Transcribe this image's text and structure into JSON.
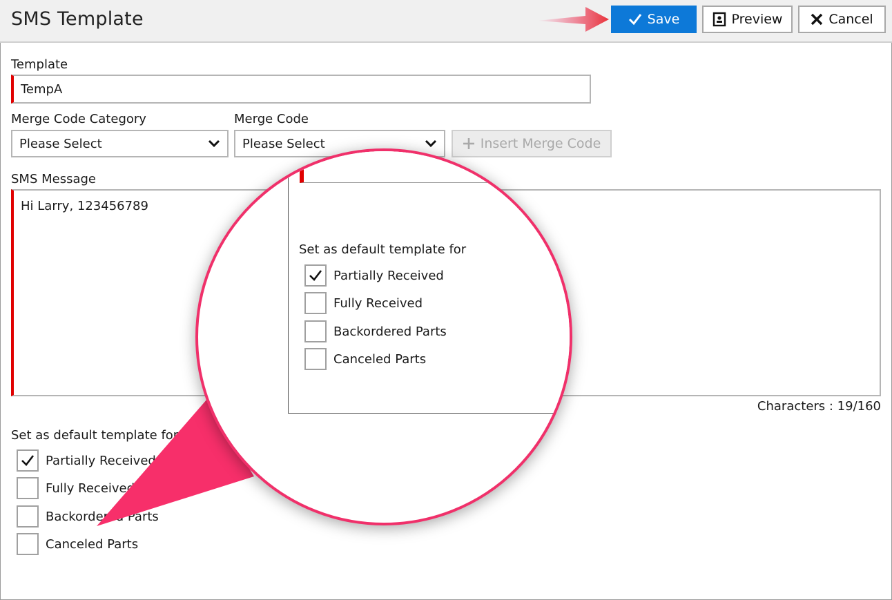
{
  "header": {
    "title": "SMS Template",
    "save_label": "Save",
    "preview_label": "Preview",
    "cancel_label": "Cancel"
  },
  "template": {
    "label": "Template",
    "value": "TempA"
  },
  "merge_code_category": {
    "label": "Merge Code Category",
    "selected": "Please Select"
  },
  "merge_code": {
    "label": "Merge Code",
    "selected": "Please Select"
  },
  "insert_merge_code": {
    "label": "Insert Merge Code"
  },
  "sms_message": {
    "label": "SMS Message",
    "value": "Hi Larry, 123456789",
    "counter": "Characters : 19/160"
  },
  "defaults": {
    "label": "Set as default template for",
    "options": [
      {
        "label": "Partially Received",
        "checked": true
      },
      {
        "label": "Fully Received",
        "checked": false
      },
      {
        "label": "Backordered Parts",
        "checked": false
      },
      {
        "label": "Canceled Parts",
        "checked": false
      }
    ]
  },
  "colors": {
    "accent": "#0d79d8",
    "required": "#e00000",
    "callout": "#f0306a"
  }
}
